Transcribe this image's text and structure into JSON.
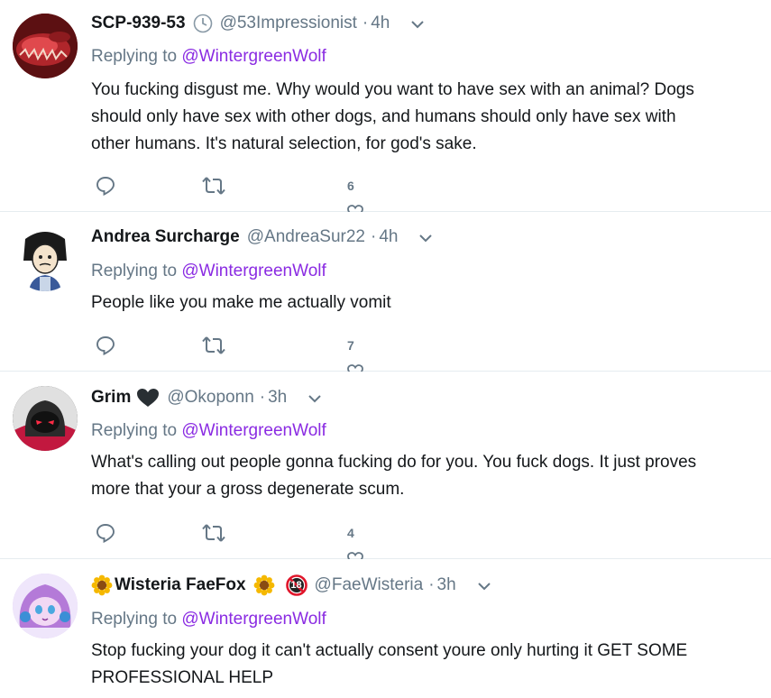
{
  "tweets": [
    {
      "name": "SCP-939-53",
      "handle": "@53Impressionist",
      "time": "4h",
      "replying_prefix": "Replying to ",
      "replying_to": "@WintergreenWolf",
      "text": "You fucking disgust me. Why would you want to have sex with an animal? Dogs\nshould only have sex with other dogs, and humans should only have sex with\nother humans. It's natural selection, for god's sake.",
      "likes": "6"
    },
    {
      "name": "Andrea Surcharge",
      "handle": "@AndreaSur22",
      "time": "4h",
      "replying_prefix": "Replying to ",
      "replying_to": "@WintergreenWolf",
      "text": "People like you make me actually vomit",
      "likes": "7"
    },
    {
      "name": "Grim",
      "handle": "@Okoponn",
      "time": "3h",
      "replying_prefix": "Replying to ",
      "replying_to": "@WintergreenWolf",
      "text": "What's calling out people gonna fucking do for you. You fuck dogs. It just proves\nmore that your a gross degenerate scum.",
      "likes": "4"
    },
    {
      "name": "Wisteria FaeFox",
      "handle": "@FaeWisteria",
      "time": "3h",
      "replying_prefix": "Replying to ",
      "replying_to": "@WintergreenWolf",
      "text": "Stop fucking your dog it can't actually consent youre only hurting it GET SOME\nPROFESSIONAL HELP",
      "badge_18": "18"
    }
  ],
  "dot": "·",
  "colors": {
    "link": "#8a2be2",
    "muted": "#657786",
    "divider": "#e6ecf0"
  }
}
